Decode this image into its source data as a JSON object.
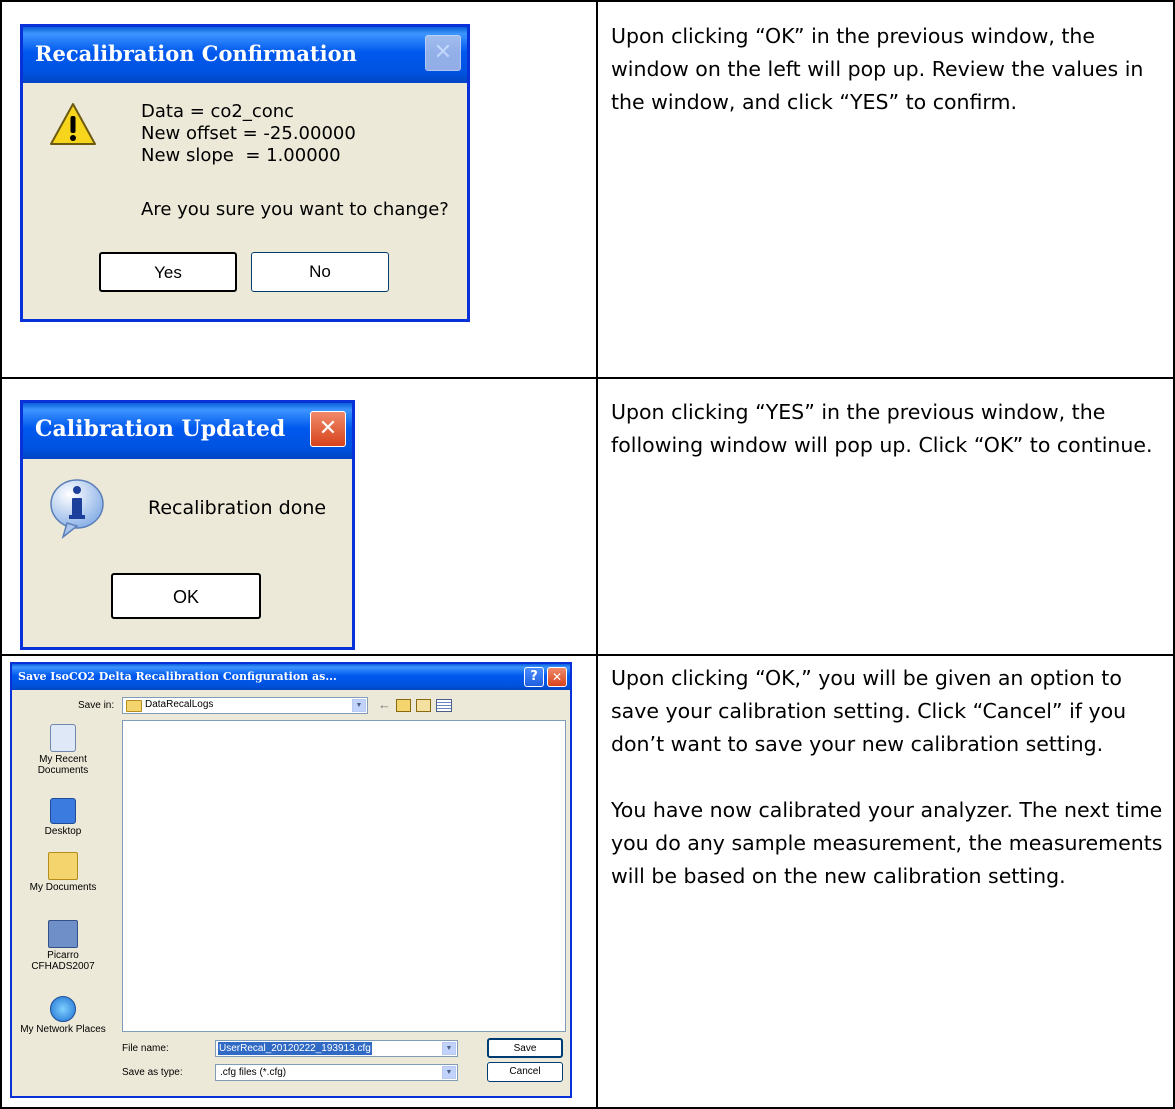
{
  "rows": [
    {
      "dialog": {
        "title": "Recalibration Confirmation",
        "close_glyph": "✕",
        "icon": "warning-icon",
        "lines": [
          "Data = co2_conc",
          "New offset = -25.00000",
          "New slope  = 1.00000"
        ],
        "question": "Are you sure you want to change?",
        "yes_label": "Yes",
        "no_label": "No"
      },
      "text": [
        "Upon clicking “OK” in the previous window, the window on the left will pop up.  Review the values in the window, and click “YES” to confirm."
      ]
    },
    {
      "dialog": {
        "title": "Calibration Updated",
        "close_glyph": "✕",
        "icon": "info-icon",
        "message": "Recalibration done",
        "ok_label": "OK"
      },
      "text": [
        "Upon clicking “YES” in the previous window, the following window will pop up. Click “OK” to continue."
      ]
    },
    {
      "dialog": {
        "title": "Save IsoCO2 Delta Recalibration Configuration as...",
        "help_glyph": "?",
        "close_glyph": "✕",
        "save_in_label": "Save in:",
        "save_in_value": "DataRecalLogs",
        "places": [
          "My Recent Documents",
          "Desktop",
          "My Documents",
          "Picarro CFHADS2007",
          "My Network Places"
        ],
        "file_name_label": "File name:",
        "file_name_value": "UserRecal_20120222_193913.cfg",
        "save_as_type_label": "Save as type:",
        "save_as_type_value": ".cfg files (*.cfg)",
        "save_label": "Save",
        "cancel_label": "Cancel"
      },
      "text": [
        "Upon clicking “OK,” you will be given an option to save your calibration setting. Click “Cancel” if you don’t want to save your new calibration setting.",
        "You have now calibrated your analyzer. The next time you do any sample measurement, the measurements will be based on the new calibration setting."
      ]
    }
  ]
}
